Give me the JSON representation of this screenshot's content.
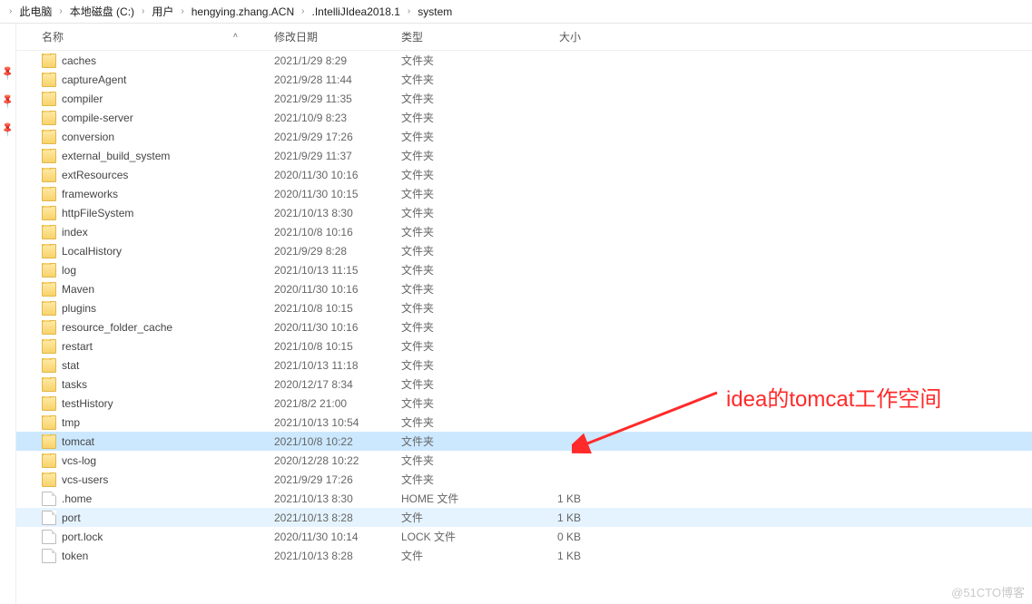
{
  "breadcrumb": [
    "此电脑",
    "本地磁盘 (C:)",
    "用户",
    "hengying.zhang.ACN",
    ".IntelliJIdea2018.1",
    "system"
  ],
  "columns": {
    "name": "名称",
    "date": "修改日期",
    "type": "类型",
    "size": "大小"
  },
  "rows": [
    {
      "icon": "folder",
      "name": "caches",
      "date": "2021/1/29 8:29",
      "type": "文件夹",
      "size": ""
    },
    {
      "icon": "folder",
      "name": "captureAgent",
      "date": "2021/9/28 11:44",
      "type": "文件夹",
      "size": ""
    },
    {
      "icon": "folder",
      "name": "compiler",
      "date": "2021/9/29 11:35",
      "type": "文件夹",
      "size": ""
    },
    {
      "icon": "folder",
      "name": "compile-server",
      "date": "2021/10/9 8:23",
      "type": "文件夹",
      "size": ""
    },
    {
      "icon": "folder",
      "name": "conversion",
      "date": "2021/9/29 17:26",
      "type": "文件夹",
      "size": ""
    },
    {
      "icon": "folder",
      "name": "external_build_system",
      "date": "2021/9/29 11:37",
      "type": "文件夹",
      "size": ""
    },
    {
      "icon": "folder",
      "name": "extResources",
      "date": "2020/11/30 10:16",
      "type": "文件夹",
      "size": ""
    },
    {
      "icon": "folder",
      "name": "frameworks",
      "date": "2020/11/30 10:15",
      "type": "文件夹",
      "size": ""
    },
    {
      "icon": "folder",
      "name": "httpFileSystem",
      "date": "2021/10/13 8:30",
      "type": "文件夹",
      "size": ""
    },
    {
      "icon": "folder",
      "name": "index",
      "date": "2021/10/8 10:16",
      "type": "文件夹",
      "size": ""
    },
    {
      "icon": "folder",
      "name": "LocalHistory",
      "date": "2021/9/29 8:28",
      "type": "文件夹",
      "size": ""
    },
    {
      "icon": "folder",
      "name": "log",
      "date": "2021/10/13 11:15",
      "type": "文件夹",
      "size": ""
    },
    {
      "icon": "folder",
      "name": "Maven",
      "date": "2020/11/30 10:16",
      "type": "文件夹",
      "size": ""
    },
    {
      "icon": "folder",
      "name": "plugins",
      "date": "2021/10/8 10:15",
      "type": "文件夹",
      "size": ""
    },
    {
      "icon": "folder",
      "name": "resource_folder_cache",
      "date": "2020/11/30 10:16",
      "type": "文件夹",
      "size": ""
    },
    {
      "icon": "folder",
      "name": "restart",
      "date": "2021/10/8 10:15",
      "type": "文件夹",
      "size": ""
    },
    {
      "icon": "folder",
      "name": "stat",
      "date": "2021/10/13 11:18",
      "type": "文件夹",
      "size": ""
    },
    {
      "icon": "folder",
      "name": "tasks",
      "date": "2020/12/17 8:34",
      "type": "文件夹",
      "size": ""
    },
    {
      "icon": "folder",
      "name": "testHistory",
      "date": "2021/8/2 21:00",
      "type": "文件夹",
      "size": ""
    },
    {
      "icon": "folder",
      "name": "tmp",
      "date": "2021/10/13 10:54",
      "type": "文件夹",
      "size": ""
    },
    {
      "icon": "folder",
      "name": "tomcat",
      "date": "2021/10/8 10:22",
      "type": "文件夹",
      "size": "",
      "selected": true
    },
    {
      "icon": "folder",
      "name": "vcs-log",
      "date": "2020/12/28 10:22",
      "type": "文件夹",
      "size": ""
    },
    {
      "icon": "folder",
      "name": "vcs-users",
      "date": "2021/9/29 17:26",
      "type": "文件夹",
      "size": ""
    },
    {
      "icon": "file",
      "name": ".home",
      "date": "2021/10/13 8:30",
      "type": "HOME 文件",
      "size": "1 KB"
    },
    {
      "icon": "file",
      "name": "port",
      "date": "2021/10/13 8:28",
      "type": "文件",
      "size": "1 KB",
      "hover": true
    },
    {
      "icon": "file",
      "name": "port.lock",
      "date": "2020/11/30 10:14",
      "type": "LOCK 文件",
      "size": "0 KB"
    },
    {
      "icon": "file",
      "name": "token",
      "date": "2021/10/13 8:28",
      "type": "文件",
      "size": "1 KB"
    }
  ],
  "annotation": {
    "text": "idea的tomcat工作空间"
  },
  "watermark": "@51CTO博客"
}
